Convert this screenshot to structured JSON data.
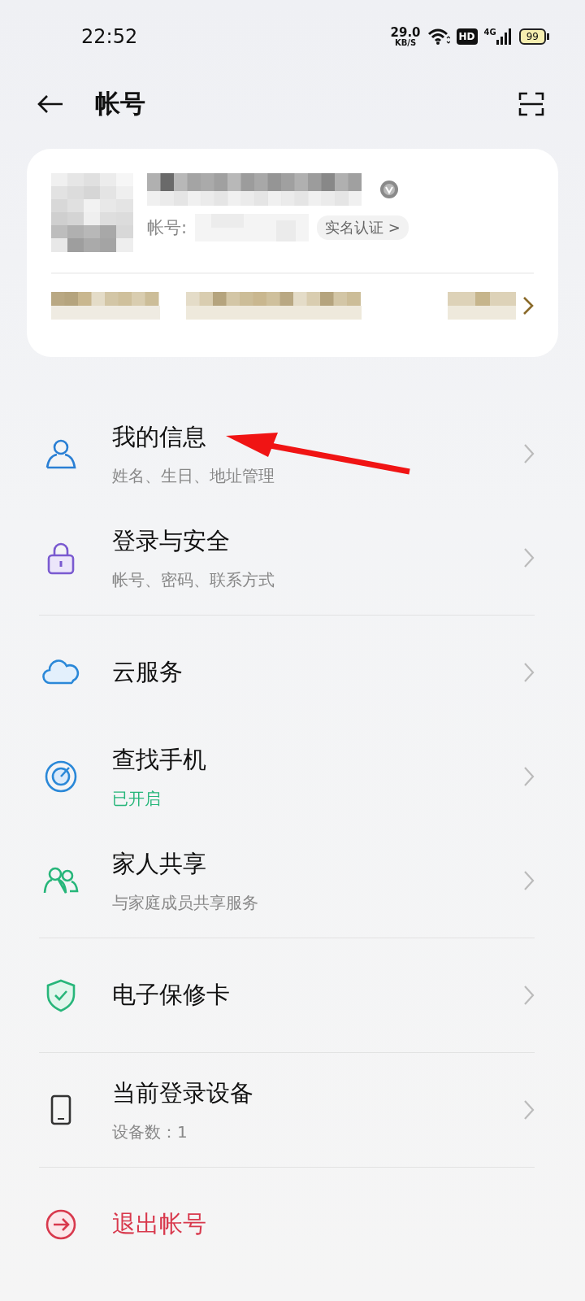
{
  "status_bar": {
    "time": "22:52",
    "speed_value": "29.0",
    "speed_unit": "KB/S",
    "hd_badge": "HD",
    "network": "4G",
    "battery": "99"
  },
  "header": {
    "title": "帐号"
  },
  "account_card": {
    "account_label": "帐号:",
    "verify_button": "实名认证 >"
  },
  "groups": [
    [
      {
        "title": "我的信息",
        "subtitle": "姓名、生日、地址管理",
        "subtitle_highlighted": false,
        "kind": "nav"
      },
      {
        "title": "登录与安全",
        "subtitle": "帐号、密码、联系方式",
        "subtitle_highlighted": false,
        "kind": "nav"
      }
    ],
    [
      {
        "title": "云服务",
        "kind": "nav"
      },
      {
        "title": "查找手机",
        "subtitle": "已开启",
        "subtitle_highlighted": true,
        "kind": "nav"
      },
      {
        "title": "家人共享",
        "subtitle": "与家庭成员共享服务",
        "subtitle_highlighted": false,
        "kind": "nav"
      }
    ],
    [
      {
        "title": "电子保修卡",
        "kind": "nav"
      }
    ],
    [
      {
        "title": "当前登录设备",
        "subtitle": "设备数：1",
        "subtitle_highlighted": false,
        "kind": "nav"
      }
    ],
    [
      {
        "title": "退出帐号",
        "kind": "action"
      }
    ]
  ]
}
